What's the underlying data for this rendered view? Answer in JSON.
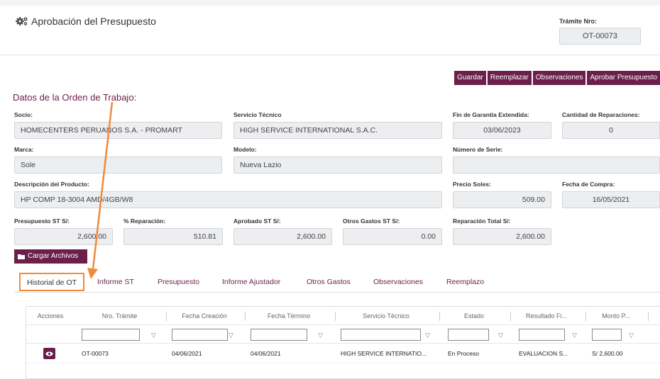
{
  "header": {
    "title": "Aprobación del Presupuesto",
    "tramite_label": "Trámite Nro:",
    "tramite_value": "OT-00073"
  },
  "actions": [
    "Guardar",
    "Reemplazar",
    "Observaciones",
    "Aprobar Presupuesto"
  ],
  "section_title": "Datos de la Orden de Trabajo:",
  "fields": {
    "socio": {
      "label": "Socio:",
      "value": "HOMECENTERS PERUANOS S.A. - PROMART"
    },
    "servicio": {
      "label": "Servicio Técnico",
      "value": "HIGH SERVICE INTERNATIONAL S.A.C."
    },
    "fin_garantia": {
      "label": "Fin de Garantía Extendida:",
      "value": "03/06/2023"
    },
    "cantidad_rep": {
      "label": "Cantidad de Reparaciones:",
      "value": "0"
    },
    "marca": {
      "label": "Marca:",
      "value": "Sole"
    },
    "modelo": {
      "label": "Modelo:",
      "value": "Nueva Lazio"
    },
    "numero_serie": {
      "label": "Número de Serie:",
      "value": ""
    },
    "descripcion": {
      "label": "Descripción del Producto:",
      "value": "HP COMP 18-3004 AMD/4GB/W8"
    },
    "precio_soles": {
      "label": "Precio Soles:",
      "value": "509.00"
    },
    "fecha_compra": {
      "label": "Fecha de Compra:",
      "value": "16/05/2021"
    },
    "presupuesto_st": {
      "label": "Presupuesto ST S/:",
      "value": "2,600.00"
    },
    "porc_reparacion": {
      "label": "% Reparación:",
      "value": "510.81"
    },
    "aprobado_st": {
      "label": "Aprobado ST S/:",
      "value": "2,600.00"
    },
    "otros_gastos": {
      "label": "Otros Gastos ST S/:",
      "value": "0.00"
    },
    "reparacion_total": {
      "label": "Reparación Total S/:",
      "value": "2,600.00"
    }
  },
  "upload_label": "Cargar Archivos",
  "tabs": [
    "Historial de OT",
    "Informe ST",
    "Presupuesto",
    "Informe Ajustador",
    "Otros Gastos",
    "Observaciones",
    "Reemplazo"
  ],
  "table": {
    "columns": [
      "Acciones",
      "Nro. Trámite",
      "Fecha Creación",
      "Fecha Término",
      "Servicio Técnico",
      "Estado",
      "Resultado Fi...",
      "Monto P..."
    ],
    "rows": [
      [
        "",
        "OT-00073",
        "04/06/2021",
        "04/06/2021",
        "HIGH SERVICE INTERNATIO...",
        "En Proceso",
        "EVALUACION S...",
        "S/ 2,600.00"
      ]
    ]
  },
  "colors": {
    "accent": "#6b1f4a",
    "highlight": "#f08a3c"
  }
}
